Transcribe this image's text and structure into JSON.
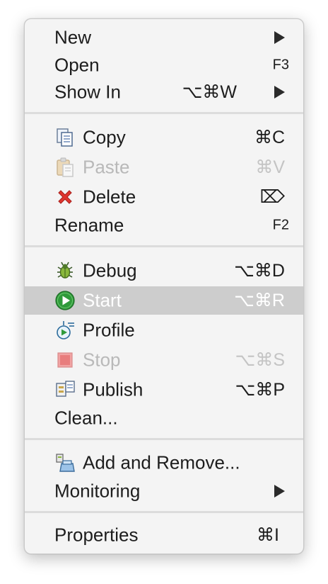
{
  "menu": {
    "new": {
      "label": "New"
    },
    "open": {
      "label": "Open",
      "shortcut": "F3"
    },
    "show_in": {
      "label": "Show In",
      "shortcut": "⌥⌘W"
    },
    "copy": {
      "label": "Copy",
      "shortcut": "⌘C",
      "icon": "copy-icon"
    },
    "paste": {
      "label": "Paste",
      "shortcut": "⌘V",
      "icon": "paste-icon",
      "enabled": false
    },
    "delete": {
      "label": "Delete",
      "shortcut": "⌦",
      "icon": "delete-icon"
    },
    "rename": {
      "label": "Rename",
      "shortcut": "F2"
    },
    "debug": {
      "label": "Debug",
      "shortcut": "⌥⌘D",
      "icon": "debug-bug-icon"
    },
    "start": {
      "label": "Start",
      "shortcut": "⌥⌘R",
      "icon": "start-icon",
      "highlighted": true
    },
    "profile": {
      "label": "Profile",
      "icon": "profile-icon"
    },
    "stop": {
      "label": "Stop",
      "shortcut": "⌥⌘S",
      "icon": "stop-icon",
      "enabled": false
    },
    "publish": {
      "label": "Publish",
      "shortcut": "⌥⌘P",
      "icon": "publish-icon"
    },
    "clean": {
      "label": "Clean..."
    },
    "add_remove": {
      "label": "Add and Remove...",
      "icon": "add-remove-icon"
    },
    "monitoring": {
      "label": "Monitoring"
    },
    "properties": {
      "label": "Properties",
      "shortcut": "⌘I"
    }
  },
  "colors": {
    "menu_background": "#f4f4f4",
    "highlight": "#cdcdcd",
    "disabled_text": "#b9b9b9",
    "start_icon_green": "#2f9a3a",
    "delete_icon_red": "#e0362f"
  }
}
